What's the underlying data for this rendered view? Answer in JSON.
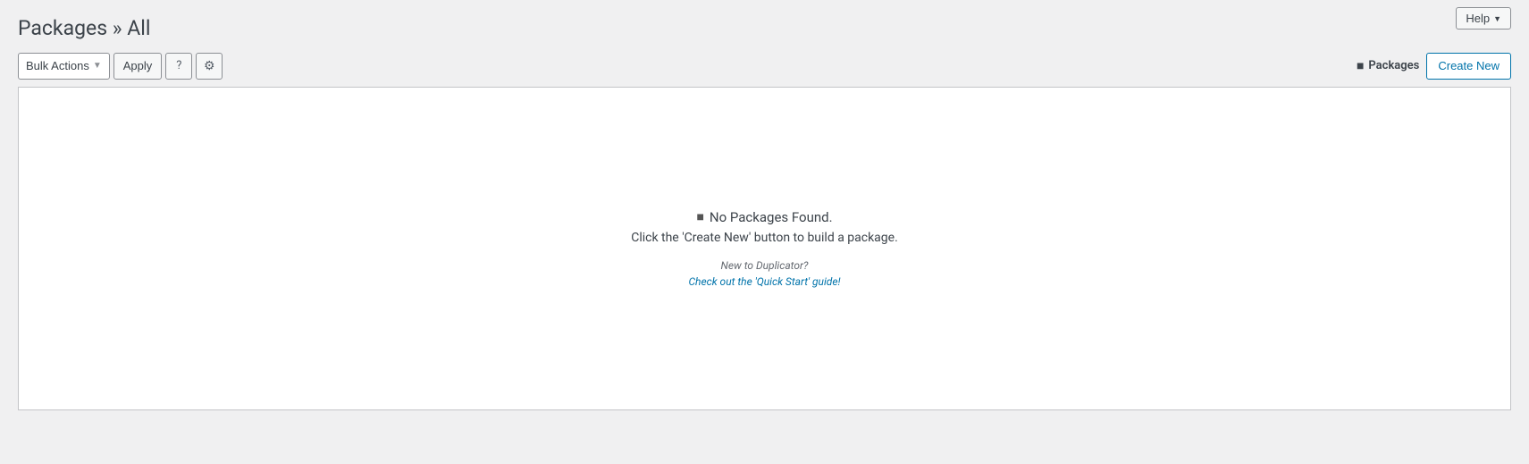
{
  "page": {
    "title": "Packages » All",
    "help_button": "Help"
  },
  "toolbar": {
    "bulk_actions_label": "Bulk Actions",
    "apply_label": "Apply",
    "question_icon": "?",
    "gear_icon": "⚙",
    "packages_label": "Packages",
    "create_new_label": "Create New"
  },
  "empty_state": {
    "icon": "📦",
    "title_prefix": " No Packages Found.",
    "subtitle": "Click the 'Create New' button to build a package.",
    "new_to_label": "New to Duplicator?",
    "quick_start_label": "Check out the 'Quick Start' guide!"
  }
}
